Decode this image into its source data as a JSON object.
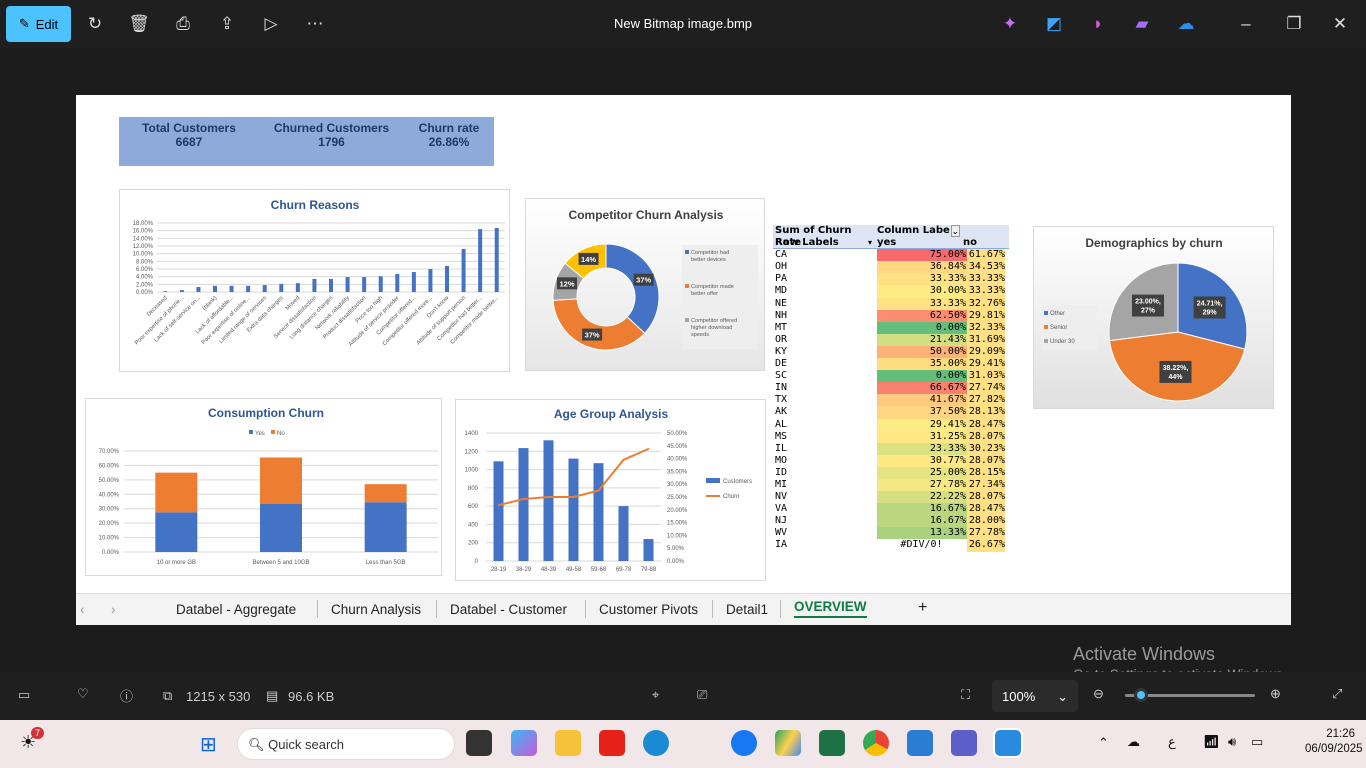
{
  "app": {
    "title": "New Bitmap image.bmp",
    "edit_label": "Edit"
  },
  "toolbar_icons": [
    "rotate-icon",
    "delete-icon",
    "print-icon",
    "share-icon",
    "slideshow-icon",
    "more-icon"
  ],
  "kpi": {
    "items": [
      {
        "label": "Total Customers",
        "value": "6687"
      },
      {
        "label": "Churned Customers",
        "value": "1796"
      },
      {
        "label": "Churn rate",
        "value": "26.86%"
      }
    ]
  },
  "colors": {
    "blue": "#4472c4",
    "orange": "#ed7d31",
    "gray": "#a5a5a5",
    "yellow": "#ffc000",
    "title": "#2f5597",
    "kpi_bg": "#8eaadb",
    "accent": "#4cc2ff"
  },
  "chart_data": [
    {
      "id": "churn_reasons",
      "type": "bar",
      "title": "Churn Reasons",
      "ylim": [
        0,
        18
      ],
      "yticks": [
        "0.00%",
        "2.00%",
        "4.00%",
        "6.00%",
        "8.00%",
        "10.00%",
        "12.00%",
        "14.00%",
        "16.00%",
        "18.00%"
      ],
      "categories": [
        "Deceased",
        "Poor expertise of phone...",
        "Lack of self-service on...",
        "(blank)",
        "Lack of affordable...",
        "Poor expertise of online...",
        "Limited range of services",
        "Extra data charges",
        "Moved",
        "Service dissatisfaction",
        "Long distance charges",
        "Network reliability",
        "Product dissatisfaction",
        "Price too high",
        "Attitude of service provider",
        "Competitor offered...",
        "Competitor offered more...",
        "Don't know",
        "Attitude of support person",
        "Competitor had better...",
        "Competitor made better..."
      ],
      "values": [
        0.2,
        0.5,
        1.3,
        1.6,
        1.6,
        1.6,
        1.8,
        2.1,
        2.3,
        3.4,
        3.4,
        3.9,
        3.9,
        4.1,
        4.7,
        5.2,
        6.0,
        6.8,
        11.2,
        16.4,
        16.7
      ]
    },
    {
      "id": "competitor",
      "type": "pie",
      "title": "Competitor Churn Analysis",
      "slices": [
        {
          "name": "Competitor had better devices",
          "value": 37,
          "label": "37%"
        },
        {
          "name": "Competitor made better offer",
          "value": 37,
          "label": "37%"
        },
        {
          "name": "Competitor offered higher download speeds",
          "value": 12,
          "label": "12%"
        },
        {
          "name": "",
          "value": 14,
          "label": "14%"
        }
      ]
    },
    {
      "id": "consumption",
      "type": "bar",
      "title": "Consumption Churn",
      "stacked": true,
      "ylim": [
        0,
        70
      ],
      "yticks": [
        "0.00%",
        "10.00%",
        "20.00%",
        "30.00%",
        "40.00%",
        "50.00%",
        "60.00%",
        "70.00%"
      ],
      "categories": [
        "10 or more GB",
        "Between 5 and 10GB",
        "Less than 5GB"
      ],
      "series": [
        {
          "name": "Yes",
          "values": [
            27.5,
            33.5,
            34.5
          ]
        },
        {
          "name": "No",
          "values": [
            27.5,
            32,
            12.5
          ]
        }
      ],
      "legend": "top"
    },
    {
      "id": "age",
      "type": "bar",
      "title": "Age Group Analysis",
      "ylim": [
        0,
        1400
      ],
      "y2lim": [
        0,
        50
      ],
      "yticks": [
        "0",
        "200",
        "400",
        "600",
        "800",
        "1000",
        "1200",
        "1400"
      ],
      "y2ticks": [
        "0.00%",
        "5.00%",
        "10.00%",
        "15.00%",
        "20.00%",
        "25.00%",
        "30.00%",
        "35.00%",
        "40.00%",
        "45.00%",
        "50.00%"
      ],
      "categories": [
        "28-19",
        "38-29",
        "48-39",
        "49-58",
        "59-68",
        "69-78",
        "79-88"
      ],
      "series": [
        {
          "name": "Customers",
          "type": "bar",
          "values": [
            1090,
            1235,
            1320,
            1120,
            1070,
            600,
            240
          ]
        },
        {
          "name": "Churn",
          "type": "line",
          "values": [
            21.8,
            24.2,
            25,
            25,
            27.5,
            39.5,
            43.8
          ]
        }
      ],
      "legend": "right"
    },
    {
      "id": "demographics",
      "type": "pie",
      "title": "Demographics by churn",
      "slices": [
        {
          "name": "Other",
          "value": 29,
          "label1": "24.71%,",
          "label2": "29%"
        },
        {
          "name": "Senior",
          "value": 44,
          "label1": "38.22%,",
          "label2": "44%"
        },
        {
          "name": "Under 30",
          "value": 27,
          "label1": "23.00%,",
          "label2": "27%"
        }
      ],
      "legend": "left"
    }
  ],
  "pivot": {
    "h1": "Sum of Churn Rate",
    "h2": "Column Labe",
    "h3": "Row Labels",
    "h4": "yes",
    "h5": "no",
    "rows": [
      [
        "CA",
        "75.00%",
        "61.67%"
      ],
      [
        "OH",
        "36.84%",
        "34.53%"
      ],
      [
        "PA",
        "33.33%",
        "33.33%"
      ],
      [
        "MD",
        "30.00%",
        "33.33%"
      ],
      [
        "NE",
        "33.33%",
        "32.76%"
      ],
      [
        "NH",
        "62.50%",
        "29.81%"
      ],
      [
        "MT",
        "0.00%",
        "32.33%"
      ],
      [
        "OR",
        "21.43%",
        "31.69%"
      ],
      [
        "KY",
        "50.00%",
        "29.09%"
      ],
      [
        "DE",
        "35.00%",
        "29.41%"
      ],
      [
        "SC",
        "0.00%",
        "31.03%"
      ],
      [
        "IN",
        "66.67%",
        "27.74%"
      ],
      [
        "TX",
        "41.67%",
        "27.82%"
      ],
      [
        "AK",
        "37.50%",
        "28.13%"
      ],
      [
        "AL",
        "29.41%",
        "28.47%"
      ],
      [
        "MS",
        "31.25%",
        "28.07%"
      ],
      [
        "IL",
        "23.33%",
        "30.23%"
      ],
      [
        "MO",
        "30.77%",
        "28.07%"
      ],
      [
        "ID",
        "25.00%",
        "28.15%"
      ],
      [
        "MI",
        "27.78%",
        "27.34%"
      ],
      [
        "NV",
        "22.22%",
        "28.07%"
      ],
      [
        "VA",
        "16.67%",
        "28.47%"
      ],
      [
        "NJ",
        "16.67%",
        "28.00%"
      ],
      [
        "WV",
        "13.33%",
        "27.78%"
      ],
      [
        "IA",
        "#DIV/0!",
        "26.67%"
      ]
    ]
  },
  "sheets": {
    "tabs": [
      "Databel - Aggregate",
      "Churn Analysis",
      "Databel - Customer",
      "Customer Pivots",
      "Detail1",
      "OVERVIEW"
    ],
    "active": 5,
    "add": "+"
  },
  "statusbar": {
    "dimensions": "1215 x 530",
    "size": "96.6 KB",
    "zoom": "100%",
    "zoom_fraction": 0.12
  },
  "watermark": {
    "line1": "Activate Windows",
    "line2": "Go to Settings to activate Windows."
  },
  "taskbar": {
    "search": "Quick search",
    "weather_badge": "7",
    "lang": "ع",
    "time": "21:26",
    "date": "06/09/2025"
  }
}
